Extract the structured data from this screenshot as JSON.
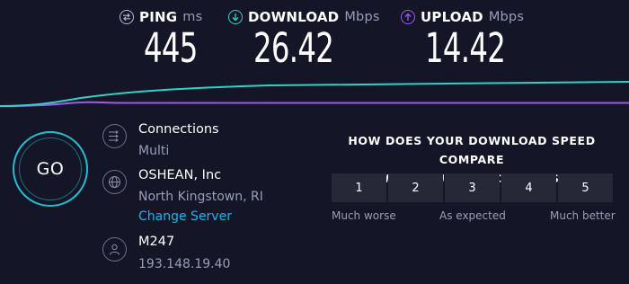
{
  "metrics": {
    "ping": {
      "label": "PING",
      "unit": "ms",
      "value": "445",
      "icon": "ping-icon"
    },
    "download": {
      "label": "DOWNLOAD",
      "unit": "Mbps",
      "value": "26.42",
      "icon": "download-arrow-icon"
    },
    "upload": {
      "label": "UPLOAD",
      "unit": "Mbps",
      "value": "14.42",
      "icon": "upload-arrow-icon"
    }
  },
  "colors": {
    "background": "#141526",
    "download": "#33d1c5",
    "upload": "#9a5cf0",
    "go_ring": "#22bfd0",
    "link": "#1ab5e5"
  },
  "go_button": {
    "label": "GO"
  },
  "connections": {
    "title": "Connections",
    "value": "Multi",
    "icon": "connections-icon"
  },
  "server": {
    "name": "OSHEAN, Inc",
    "location": "North Kingstown, RI",
    "change_label": "Change Server",
    "icon": "globe-icon"
  },
  "host": {
    "name": "M247",
    "ip": "193.148.19.40",
    "icon": "user-icon"
  },
  "survey": {
    "question_line1": "HOW DOES YOUR DOWNLOAD SPEED COMPARE",
    "question_line2": "WITH YOUR EXPECTATIONS?",
    "options": [
      "1",
      "2",
      "3",
      "4",
      "5"
    ],
    "low_label": "Much worse",
    "mid_label": "As expected",
    "high_label": "Much better"
  }
}
